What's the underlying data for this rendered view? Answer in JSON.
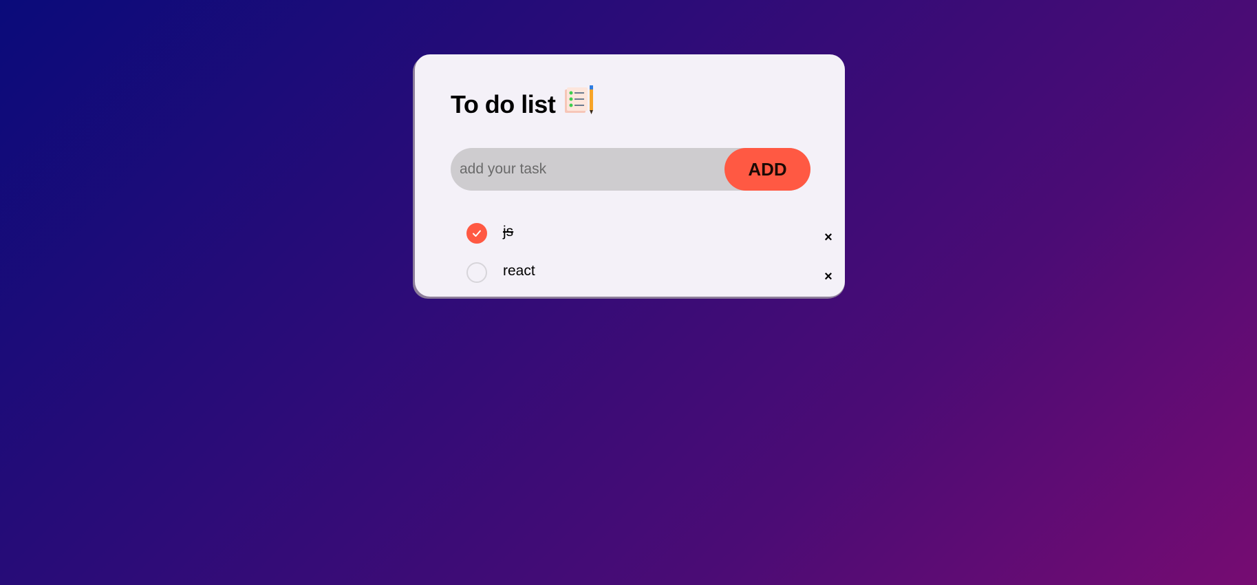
{
  "app": {
    "title": "To do list",
    "title_icon": "checklist-notepad-pencil-icon"
  },
  "input": {
    "placeholder": "add your task",
    "value": ""
  },
  "add_button": {
    "label": "ADD"
  },
  "tasks": [
    {
      "text": "js",
      "completed": true,
      "delete_label": "×"
    },
    {
      "text": "react",
      "completed": false,
      "delete_label": "×"
    }
  ],
  "colors": {
    "accent": "#ff5943",
    "card_background": "#f4f1f8",
    "input_background": "#cecccf",
    "gradient_start": "#0a0b7a",
    "gradient_end": "#760c72"
  }
}
